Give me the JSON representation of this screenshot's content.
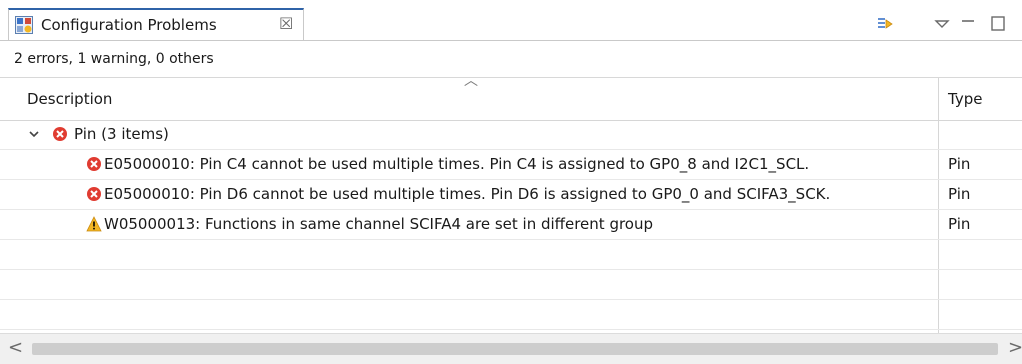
{
  "tab": {
    "title": "Configuration Problems",
    "close_glyph": "☒"
  },
  "view_actions": {
    "focus_icon": "focus-on-active-task-icon",
    "menu_icon": "view-menu-chevron-icon",
    "minimize_icon": "minimize-icon",
    "maximize_icon": "maximize-icon"
  },
  "status": "2 errors, 1 warning, 0 others",
  "table": {
    "columns": [
      "Description",
      "Type"
    ],
    "group": {
      "label": "Pin (3 items)"
    },
    "rows": [
      {
        "severity": "error",
        "description": "E05000010: Pin C4 cannot be used multiple times. Pin C4 is assigned to GP0_8 and I2C1_SCL.",
        "type": "Pin"
      },
      {
        "severity": "error",
        "description": "E05000010: Pin D6 cannot be used multiple times. Pin D6 is assigned to GP0_0 and SCIFA3_SCK.",
        "type": "Pin"
      },
      {
        "severity": "warning",
        "description": "W05000013: Functions in same channel SCIFA4 are set in different group",
        "type": "Pin"
      }
    ]
  },
  "colors": {
    "error": "#e03c31",
    "warning": "#f3b623",
    "accent": "#2f63a8"
  }
}
